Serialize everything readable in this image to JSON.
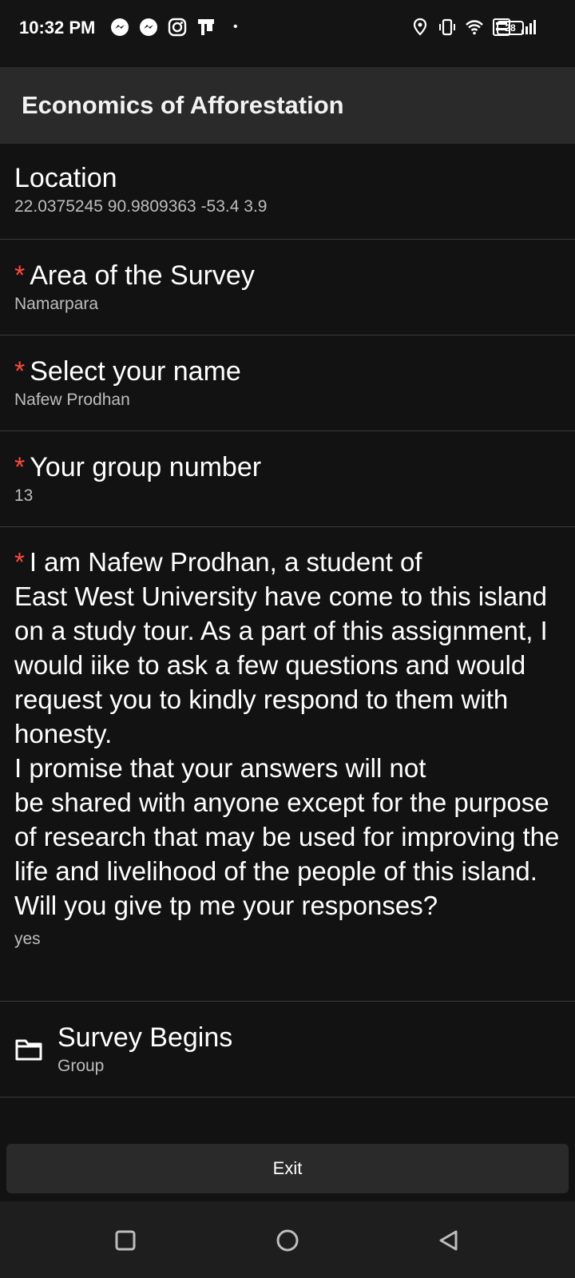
{
  "status_bar": {
    "time": "10:32 PM",
    "dot": "•",
    "battery_level": "28",
    "left_icons": [
      "messenger-icon",
      "messenger-icon",
      "instagram-icon",
      "notification-icon"
    ],
    "right_icons": [
      "location-icon",
      "vibrate-icon",
      "wifi-icon",
      "volte-icon",
      "signal-icon",
      "battery-icon"
    ]
  },
  "app_bar": {
    "title": "Economics of Afforestation"
  },
  "form": {
    "location": {
      "label": "Location",
      "value": "22.0375245 90.9809363 -53.4 3.9"
    },
    "area": {
      "required_mark": "*",
      "label": "Area of the Survey",
      "value": "Namarpara"
    },
    "name": {
      "required_mark": "*",
      "label": "Select your name",
      "value": "Nafew Prodhan"
    },
    "group": {
      "required_mark": "*",
      "label": "Your group number",
      "value": "13"
    },
    "consent": {
      "required_mark": "*",
      "label": "I am Nafew Prodhan, a student of\nEast West University have come to this island on a study tour. As a part of this assignment, I would iike to ask a few questions and would request you to kindly respond to them with honesty.\nI promise that your answers will not\nbe shared with anyone except for the purpose of research that may be used for improving the life and livelihood of the people of this island. Will you give tp me your responses?",
      "value": "yes"
    },
    "survey_group": {
      "label": "Survey Begins",
      "type": "Group",
      "icon": "folder-icon"
    }
  },
  "exit_label": "Exit",
  "nav_bar": {
    "icons": [
      "recents-icon",
      "home-icon",
      "back-icon"
    ]
  }
}
